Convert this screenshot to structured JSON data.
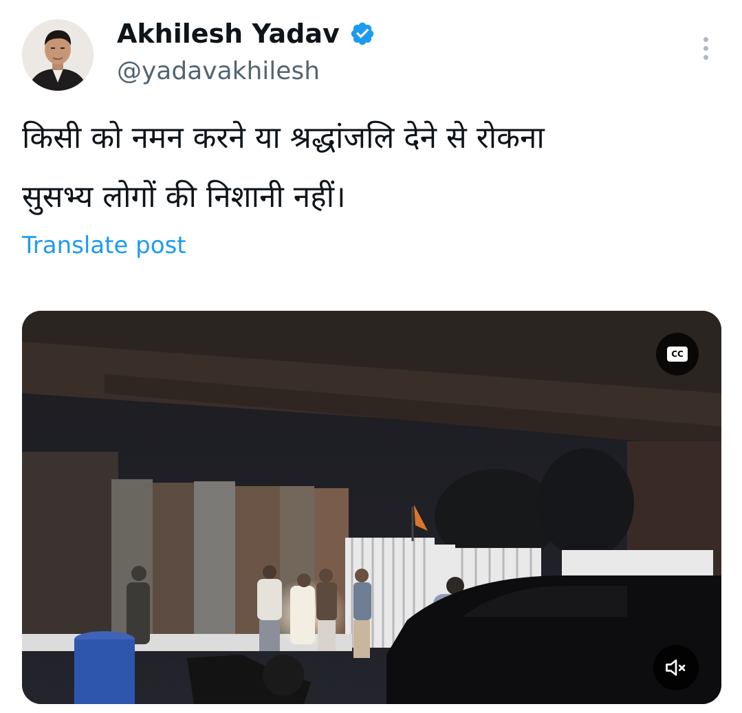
{
  "author": {
    "name": "Akhilesh Yadav",
    "handle": "@yadavakhilesh",
    "verified": true,
    "verified_color": "#1d9bf0"
  },
  "post": {
    "text_line1": "किसी को नमन करने या श्रद्धांजलि देने से रोकना",
    "text_line2": "सुसभ्य लोगों की निशानी नहीं।",
    "translate_label": "Translate post"
  },
  "media": {
    "type": "video",
    "cc_label": "CC",
    "captions_icon": "closed-captions-icon",
    "mute_icon": "speaker-muted-icon",
    "menu_icon": "more-vertical-icon"
  },
  "colors": {
    "text_primary": "#0f1419",
    "text_secondary": "#536471",
    "link": "#1d9bf0"
  }
}
